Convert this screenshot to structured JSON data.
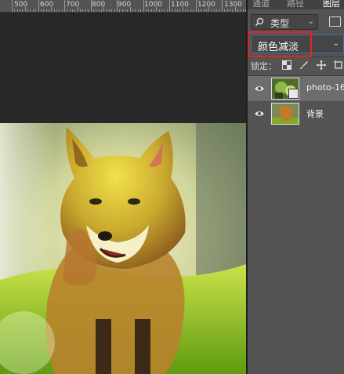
{
  "ruler": {
    "ticks": [
      "500",
      "600",
      "700",
      "800",
      "900",
      "1000",
      "1100",
      "1200",
      "1300"
    ]
  },
  "layers_panel": {
    "tabs": [
      "通道",
      "路径",
      "图层"
    ],
    "filter": {
      "kind_label": "类型",
      "search_icon": "search-icon",
      "image_filter_icon": "image-filter-icon"
    },
    "blend_mode": {
      "value": "颜色减淡",
      "highlight_color": "#e8231f"
    },
    "lock": {
      "label": "锁定：",
      "icons": [
        "lock-transparent-icon",
        "lock-paint-icon",
        "lock-move-icon",
        "lock-artboard-icon"
      ]
    },
    "layers": [
      {
        "name": "photo-16",
        "selected": true,
        "visible": true
      },
      {
        "name": "背景",
        "selected": false,
        "visible": true
      }
    ]
  },
  "colors": {
    "canvas_bg": "#282828",
    "panel_bg": "#535353",
    "selected_layer": "#6d6d6d",
    "accent_border": "#3d6fb3"
  }
}
